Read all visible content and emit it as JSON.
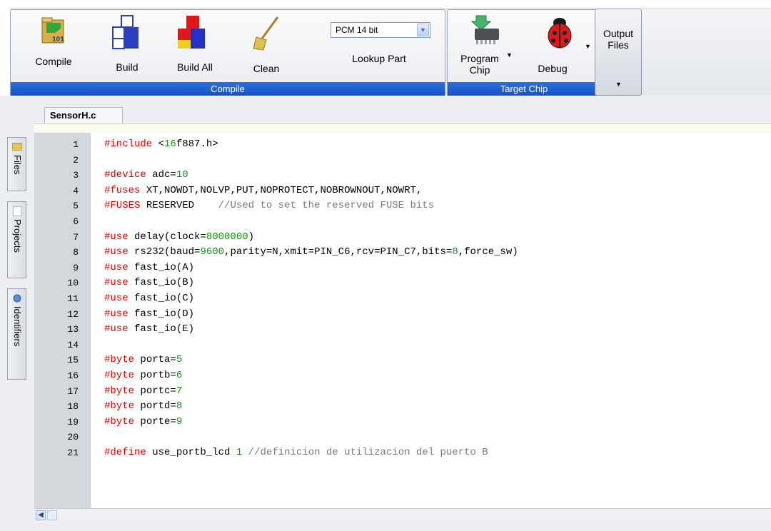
{
  "ribbon": {
    "compile_group": {
      "caption": "Compile",
      "buttons": [
        {
          "label": "Compile",
          "icon": "compile-folder-icon"
        },
        {
          "label": "Build",
          "icon": "build-blocks-icon"
        },
        {
          "label": "Build All",
          "icon": "build-all-blocks-icon"
        },
        {
          "label": "Clean",
          "icon": "broom-icon"
        }
      ],
      "compiler_select": {
        "value": "PCM 14 bit"
      },
      "lookup_part": "Lookup Part"
    },
    "target_group": {
      "caption": "Target Chip",
      "program_chip": {
        "line1": "Program",
        "line2": "Chip",
        "icon": "chip-icon"
      },
      "debug": {
        "label": "Debug",
        "icon": "ladybug-icon"
      }
    },
    "output_files": {
      "line1": "Output",
      "line2": "Files"
    }
  },
  "editor": {
    "tab_label": "SensorH.c",
    "sidebar": [
      "Files",
      "Projects",
      "Identifiers"
    ],
    "lines": [
      {
        "n": "1",
        "t": [
          {
            "c": "kw",
            "v": "#include"
          },
          {
            "c": "",
            "v": " <"
          },
          {
            "c": "num",
            "v": "16"
          },
          {
            "c": "",
            "v": "f887.h>"
          }
        ]
      },
      {
        "n": "2",
        "t": []
      },
      {
        "n": "3",
        "t": [
          {
            "c": "kw",
            "v": "#device"
          },
          {
            "c": "",
            "v": " adc="
          },
          {
            "c": "num",
            "v": "10"
          }
        ]
      },
      {
        "n": "4",
        "t": [
          {
            "c": "kw",
            "v": "#fuses"
          },
          {
            "c": "",
            "v": " XT,NOWDT,NOLVP,PUT,NOPROTECT,NOBROWNOUT,NOWRT,"
          }
        ]
      },
      {
        "n": "5",
        "t": [
          {
            "c": "kw",
            "v": "#FUSES"
          },
          {
            "c": "",
            "v": " RESERVED    "
          },
          {
            "c": "cm",
            "v": "//Used to set the reserved FUSE bits"
          }
        ]
      },
      {
        "n": "6",
        "t": []
      },
      {
        "n": "7",
        "t": [
          {
            "c": "kw",
            "v": "#use"
          },
          {
            "c": "",
            "v": " delay(clock="
          },
          {
            "c": "num",
            "v": "8000000"
          },
          {
            "c": "",
            "v": ")"
          }
        ]
      },
      {
        "n": "8",
        "t": [
          {
            "c": "kw",
            "v": "#use"
          },
          {
            "c": "",
            "v": " rs232(baud="
          },
          {
            "c": "num",
            "v": "9600"
          },
          {
            "c": "",
            "v": ",parity=N,xmit=PIN_C6,rcv=PIN_C7,bits="
          },
          {
            "c": "num",
            "v": "8"
          },
          {
            "c": "",
            "v": ",force_sw)"
          }
        ]
      },
      {
        "n": "9",
        "t": [
          {
            "c": "kw",
            "v": "#use"
          },
          {
            "c": "",
            "v": " fast_io(A)"
          }
        ]
      },
      {
        "n": "10",
        "t": [
          {
            "c": "kw",
            "v": "#use"
          },
          {
            "c": "",
            "v": " fast_io(B)"
          }
        ]
      },
      {
        "n": "11",
        "t": [
          {
            "c": "kw",
            "v": "#use"
          },
          {
            "c": "",
            "v": " fast_io(C)"
          }
        ]
      },
      {
        "n": "12",
        "t": [
          {
            "c": "kw",
            "v": "#use"
          },
          {
            "c": "",
            "v": " fast_io(D)"
          }
        ]
      },
      {
        "n": "13",
        "t": [
          {
            "c": "kw",
            "v": "#use"
          },
          {
            "c": "",
            "v": " fast_io(E)"
          }
        ]
      },
      {
        "n": "14",
        "t": []
      },
      {
        "n": "15",
        "t": [
          {
            "c": "kw",
            "v": "#byte"
          },
          {
            "c": "",
            "v": " porta="
          },
          {
            "c": "num",
            "v": "5"
          }
        ]
      },
      {
        "n": "16",
        "t": [
          {
            "c": "kw",
            "v": "#byte"
          },
          {
            "c": "",
            "v": " portb="
          },
          {
            "c": "num",
            "v": "6"
          }
        ]
      },
      {
        "n": "17",
        "t": [
          {
            "c": "kw",
            "v": "#byte"
          },
          {
            "c": "",
            "v": " portc="
          },
          {
            "c": "num",
            "v": "7"
          }
        ]
      },
      {
        "n": "18",
        "t": [
          {
            "c": "kw",
            "v": "#byte"
          },
          {
            "c": "",
            "v": " portd="
          },
          {
            "c": "num",
            "v": "8"
          }
        ]
      },
      {
        "n": "19",
        "t": [
          {
            "c": "kw",
            "v": "#byte"
          },
          {
            "c": "",
            "v": " porte="
          },
          {
            "c": "num",
            "v": "9"
          }
        ]
      },
      {
        "n": "20",
        "t": []
      },
      {
        "n": "21",
        "t": [
          {
            "c": "kw",
            "v": "#define"
          },
          {
            "c": "",
            "v": " use_portb_lcd "
          },
          {
            "c": "num",
            "v": "1"
          },
          {
            "c": "",
            "v": " "
          },
          {
            "c": "cm",
            "v": "//definicion de utilizacion del puerto B"
          }
        ]
      }
    ]
  }
}
